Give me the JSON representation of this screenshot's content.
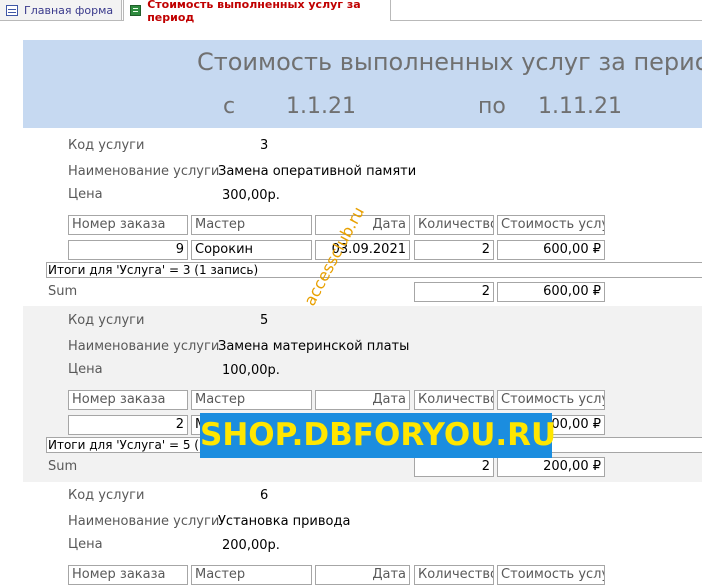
{
  "tabs": [
    {
      "label": "Главная форма"
    },
    {
      "label": "Стоимость выполненных услуг за период"
    }
  ],
  "report": {
    "title": "Стоимость выполненных услуг за период",
    "from_label": "с",
    "from_date": "1.1.21",
    "to_label": "по",
    "to_date": "1.11.21"
  },
  "labels": {
    "code": "Код услуги",
    "name": "Наименование услуги",
    "price": "Цена",
    "sum": "Sum"
  },
  "columns": [
    "Номер заказа",
    "Мастер",
    "Дата",
    "Количество",
    "Стоимость услуг"
  ],
  "groups": [
    {
      "code": "3",
      "name": "Замена оперативной памяти",
      "price": "300,00р.",
      "rows": [
        {
          "order": "9",
          "master": "Сорокин",
          "date": "03.09.2021",
          "qty": "2",
          "cost": "600,00 ₽"
        }
      ],
      "total_text": "Итоги для 'Услуга' = 3 (1 запись)",
      "sum_qty": "2",
      "sum_cost": "600,00 ₽"
    },
    {
      "code": "5",
      "name": "Замена материнской платы",
      "price": "100,00р.",
      "rows": [
        {
          "order": "2",
          "master": "М",
          "date": "",
          "qty": "",
          "cost": "200,00 ₽"
        }
      ],
      "total_text": "Итоги для 'Услуга' = 5 (1",
      "sum_qty": "2",
      "sum_cost": "200,00 ₽"
    },
    {
      "code": "6",
      "name": "Установка привода",
      "price": "200,00р."
    }
  ],
  "watermarks": {
    "diagonal": "accessclub.ru",
    "banner": "SHOP.DBFORYOU.RU"
  },
  "colors": {
    "header_bg": "#c6d9f1",
    "band_bg": "#f2f2f2",
    "active_tab": "#c00000",
    "banner_bg": "#1b8ddf",
    "banner_text": "#ffe600",
    "diagonal_wm": "#e8a000"
  }
}
